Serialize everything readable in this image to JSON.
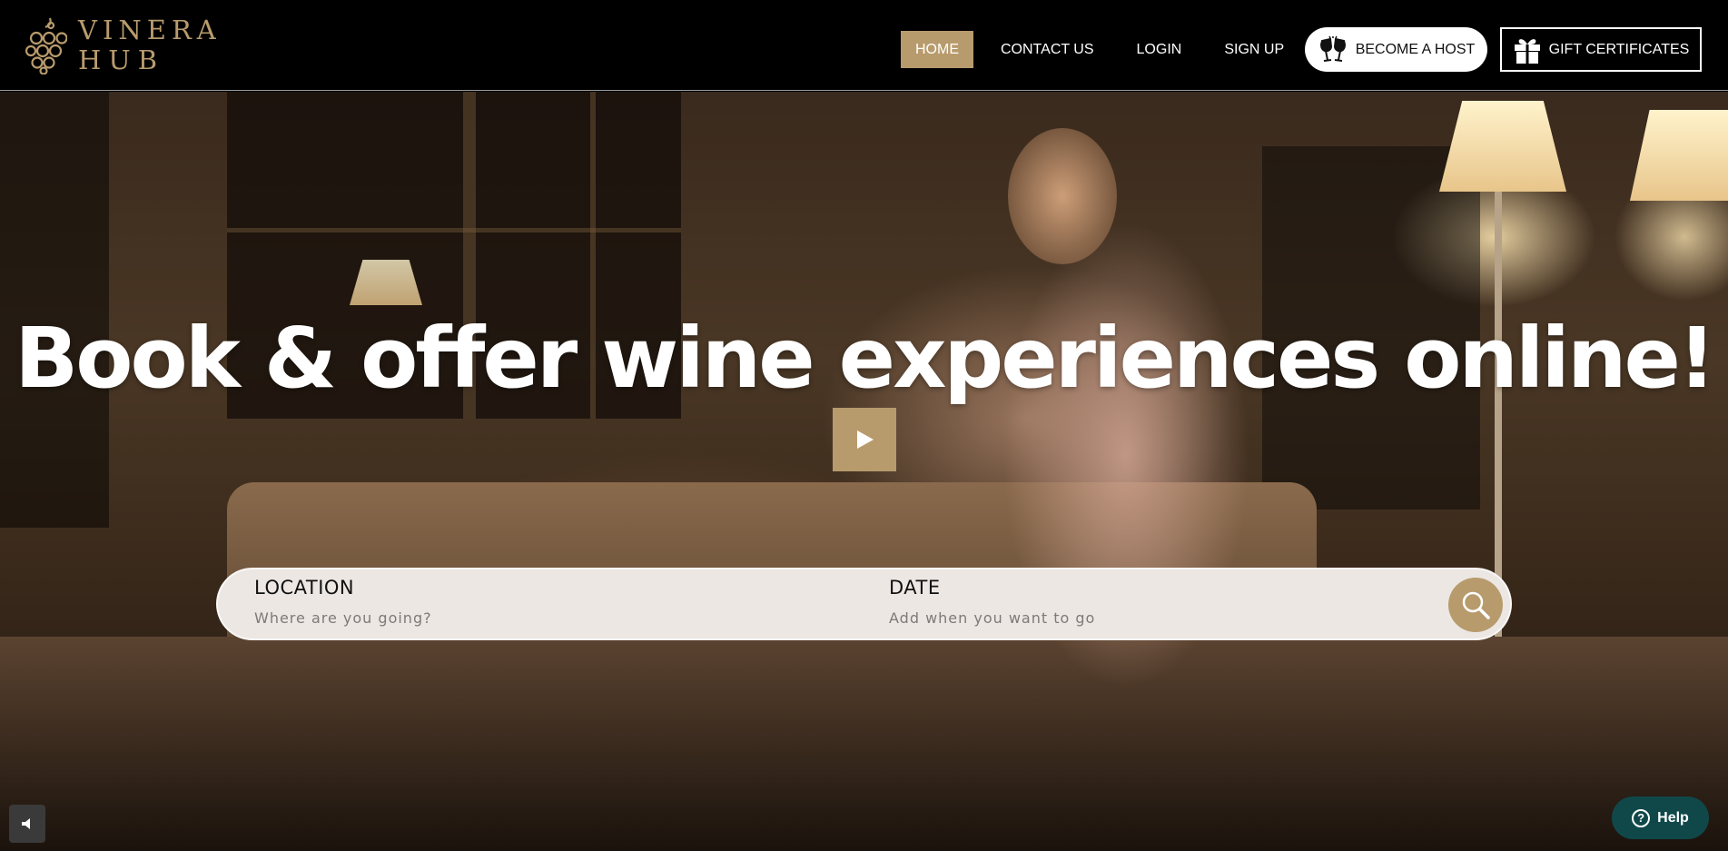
{
  "logo": {
    "line1": "VINERA",
    "line2": "HUB",
    "icon": "grapes-icon"
  },
  "nav": {
    "home": "HOME",
    "contact": "CONTACT US",
    "login": "LOGIN",
    "signup": "SIGN UP",
    "active": "HOME"
  },
  "become_host": {
    "label": "BECOME A HOST",
    "icon": "wine-glasses-icon"
  },
  "gift": {
    "label": "GIFT CERTIFICATES",
    "icon": "gift-icon"
  },
  "hero": {
    "headline": "Book & offer wine experiences online!",
    "play_icon": "play-icon"
  },
  "search": {
    "location_label": "LOCATION",
    "location_placeholder": "Where are you going?",
    "date_label": "DATE",
    "date_placeholder": "Add when you want to go",
    "button_icon": "magnifier-icon"
  },
  "help": {
    "label": "Help",
    "icon": "question-icon"
  },
  "mute": {
    "icon": "speaker-icon"
  },
  "colors": {
    "accent": "#b89b6d",
    "nav_bg": "#000000",
    "help_bg": "#10484a",
    "search_bg": "#ece7e3"
  }
}
